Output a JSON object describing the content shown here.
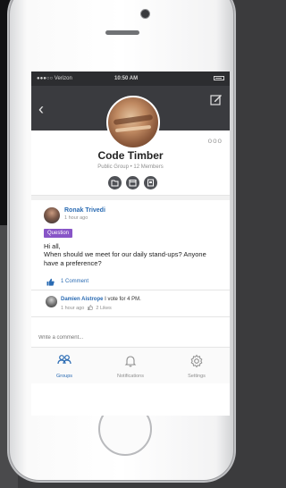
{
  "status_bar": {
    "carrier": "●●●○○ Verizon",
    "time": "10:50 AM"
  },
  "group": {
    "name": "Code Timber",
    "meta": "Public Group • 12 Members",
    "more": "ooo"
  },
  "post": {
    "author": "Ronak Trivedi",
    "time": "1 hour ago",
    "tag": "Question",
    "greeting": "Hi all,",
    "body": "When should we meet for our daily stand-ups? Anyone have a preference?",
    "comment_count": "1 Comment"
  },
  "reply": {
    "author": "Damien Aistrope",
    "text": "I vote for 4 PM.",
    "time": "1 hour ago",
    "likes": "2 Likes"
  },
  "comment_input": {
    "placeholder": "Write a comment..."
  },
  "tabs": [
    {
      "label": "Groups",
      "icon": "groups-icon"
    },
    {
      "label": "Notifications",
      "icon": "bell-icon"
    },
    {
      "label": "Settings",
      "icon": "gear-icon"
    }
  ],
  "colors": {
    "accent": "#2a6bb3",
    "tag": "#8855c7",
    "header": "#3a3b3f"
  }
}
